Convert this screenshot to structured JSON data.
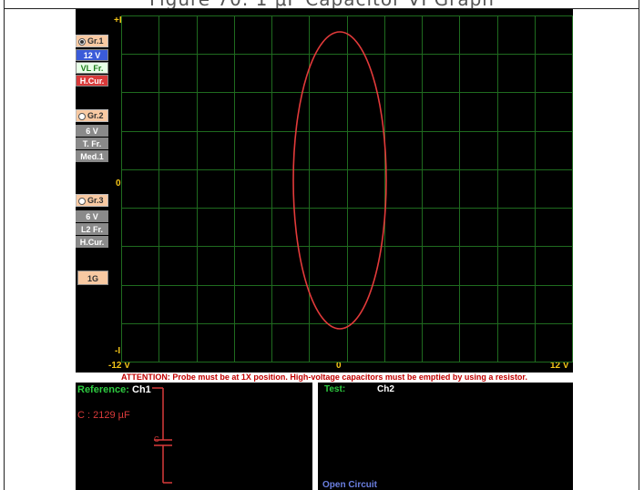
{
  "caption": "Figure 70. 1 μF Capacitor VI Graph",
  "sidebar": {
    "group1": {
      "label": "Gr.1",
      "voltage": "12 V",
      "freq": "VL Fr.",
      "current": "H.Cur."
    },
    "group2": {
      "label": "Gr.2",
      "voltage": "6 V",
      "freq": "T. Fr.",
      "current": "Med.1"
    },
    "group3": {
      "label": "Gr.3",
      "voltage": "6 V",
      "freq": "L2 Fr.",
      "current": "H.Cur."
    },
    "one_g": "1G"
  },
  "plot": {
    "y_top": "+I",
    "y_mid": "0",
    "y_bottom": "-I",
    "x_left": "-12 V",
    "x_mid": "0",
    "x_right": "12 V"
  },
  "warning": "ATTENTION: Probe must be at 1X position. High-voltage capacitors must be emptied by using a resistor.",
  "reference": {
    "label": "Reference:",
    "channel": "Ch1",
    "value": "C : 2129 µF",
    "component": "C"
  },
  "test": {
    "label": "Test:",
    "channel": "Ch2",
    "status": "Open Circuit"
  },
  "colors": {
    "grid": "#1f6b1f",
    "trace": "#e23a3a",
    "axis_text": "#f5c518",
    "button_blue": "#3a5bd9",
    "button_red": "#d93a3a",
    "button_gray": "#8a8a8a",
    "radio_peach": "#f8c9a2"
  }
}
